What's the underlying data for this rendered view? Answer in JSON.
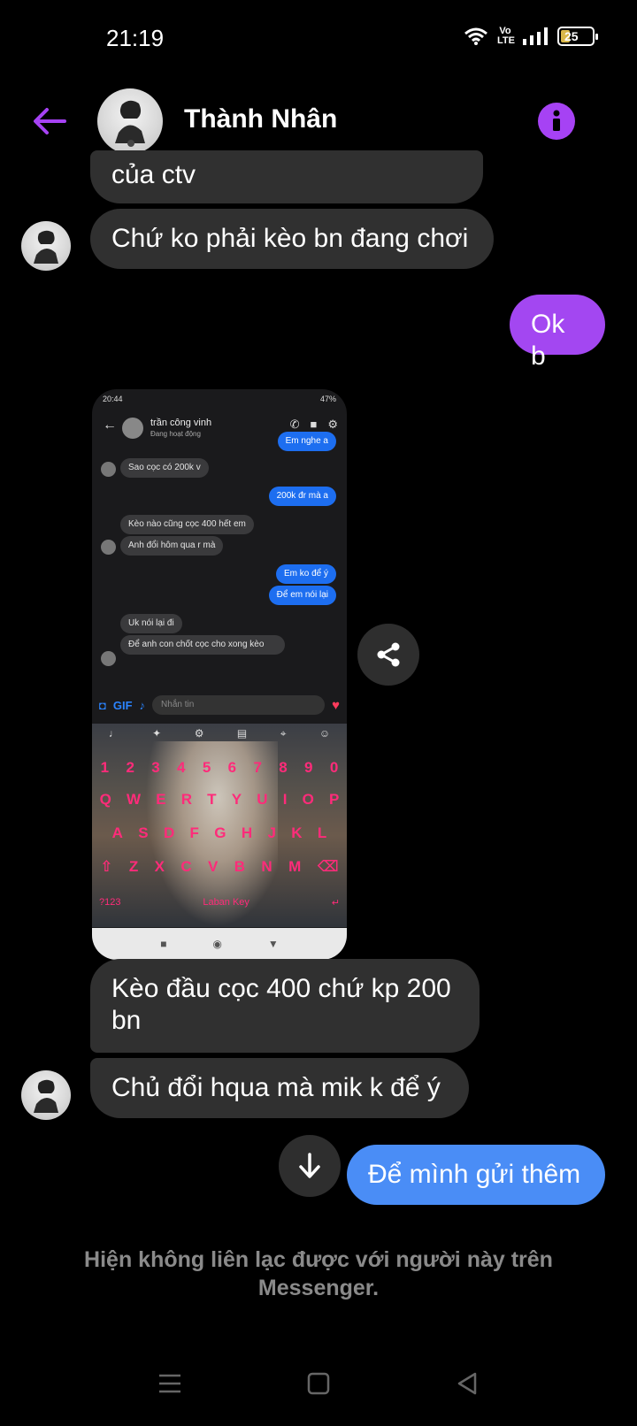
{
  "status_bar": {
    "time": "21:19",
    "network": "Vo LTE",
    "battery_level": "25"
  },
  "header": {
    "contact_name": "Thành Nhân"
  },
  "messages": {
    "m1": "của ctv",
    "m2": "Chứ ko phải kèo bn đang chơi",
    "m3": "Ok b",
    "m4": "Kèo đầu cọc 400 chứ kp 200 bn",
    "m5": "Chủ đổi hqua mà mik k để ý",
    "m6": "Để mình gửi thêm"
  },
  "attachment": {
    "status_time": "20:44",
    "status_battery": "47%",
    "contact_name": "trần công vinh",
    "contact_status": "Đang hoạt động",
    "msgs": {
      "a1": "Em nghe a",
      "a2": "Sao cọc có 200k v",
      "a3": "200k đr mà a",
      "a4": "Kèo nào cũng cọc 400 hết em",
      "a5": "Anh đổi hôm qua r mà",
      "a6": "Em ko để ý",
      "a7": "Để em nói lại",
      "a8": "Uk nói lại đi",
      "a9": "Để anh con chốt cọc cho xong kèo"
    },
    "composer_placeholder": "Nhắn tin",
    "gif_label": "GIF",
    "keyboard": {
      "row_numbers": [
        "1",
        "2",
        "3",
        "4",
        "5",
        "6",
        "7",
        "8",
        "9",
        "0"
      ],
      "row_1": [
        "Q",
        "W",
        "E",
        "R",
        "T",
        "Y",
        "U",
        "I",
        "O",
        "P"
      ],
      "row_2": [
        "A",
        "S",
        "D",
        "F",
        "G",
        "H",
        "J",
        "K",
        "L"
      ],
      "row_3": [
        "⇧",
        "Z",
        "X",
        "C",
        "V",
        "B",
        "N",
        "M",
        "⌫"
      ],
      "mode_key": "?123",
      "brand": "Laban Key",
      "enter_key": "↵"
    }
  },
  "footer": {
    "unavailable_text": "Hiện không liên lạc được với người này trên Messenger."
  },
  "colors": {
    "accent_purple": "#a347f1",
    "blue_bubble": "#4a8df6",
    "incoming_bubble": "#303030"
  }
}
